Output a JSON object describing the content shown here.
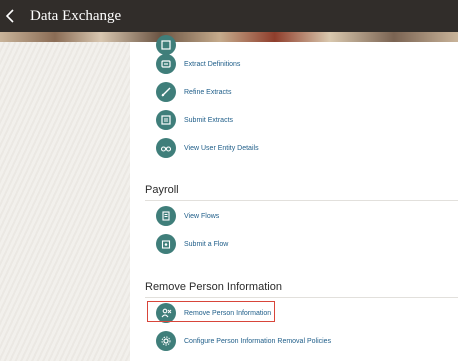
{
  "header": {
    "title": "Data Exchange"
  },
  "sections": [
    {
      "title": "",
      "items": [
        {
          "label": "Extract Definitions",
          "icon": "extract-definitions-icon"
        },
        {
          "label": "Refine Extracts",
          "icon": "refine-extracts-icon"
        },
        {
          "label": "Submit Extracts",
          "icon": "submit-extracts-icon"
        },
        {
          "label": "View User Entity Details",
          "icon": "user-entity-icon"
        }
      ]
    },
    {
      "title": "Payroll",
      "items": [
        {
          "label": "View Flows",
          "icon": "view-flows-icon"
        },
        {
          "label": "Submit a Flow",
          "icon": "submit-flow-icon"
        }
      ]
    },
    {
      "title": "Remove Person Information",
      "items": [
        {
          "label": "Remove Person Information",
          "icon": "remove-person-icon"
        },
        {
          "label": "Configure Person Information Removal Policies",
          "icon": "configure-policies-icon"
        }
      ]
    }
  ],
  "colors": {
    "header_bg": "#312d2a",
    "icon_bg": "#3f7e7a",
    "link": "#1f5e89",
    "highlight": "#d8453a"
  }
}
